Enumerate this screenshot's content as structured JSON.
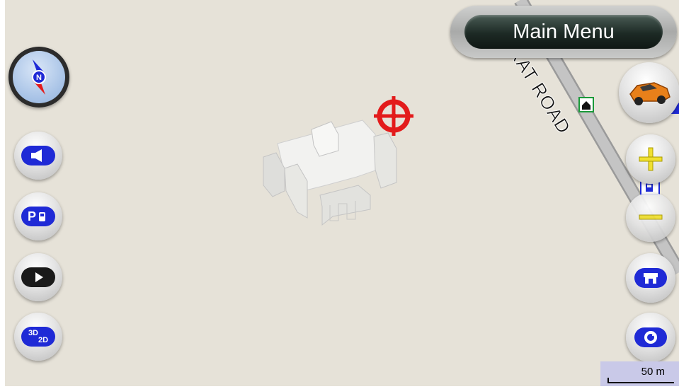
{
  "map": {
    "road_name": "RAT ROAD",
    "background_color": "#e6e2d8",
    "road_color": "#b9b9b9"
  },
  "top_bar": {
    "main_menu_label": "Main Menu"
  },
  "left_buttons": [
    {
      "name": "compass",
      "icon": "compass-icon",
      "label": "N"
    },
    {
      "name": "sound",
      "icon": "speaker-icon"
    },
    {
      "name": "parking",
      "icon": "parking-fuel-icon",
      "label": "P"
    },
    {
      "name": "play",
      "icon": "play-icon"
    },
    {
      "name": "view-mode",
      "icon": "3d-2d-icon",
      "label_top": "3D",
      "label_bottom": "2D"
    }
  ],
  "right_buttons": [
    {
      "name": "car-position",
      "icon": "car-icon"
    },
    {
      "name": "zoom-in",
      "icon": "plus-icon"
    },
    {
      "name": "zoom-out",
      "icon": "minus-icon"
    },
    {
      "name": "poi",
      "icon": "store-icon"
    },
    {
      "name": "rotate",
      "icon": "rotate-icon"
    }
  ],
  "scale": {
    "label": "50 m"
  },
  "colors": {
    "accent_blue": "#1f2ad6",
    "target_red": "#e31b1b",
    "zoom_yellow": "#f0e030"
  }
}
